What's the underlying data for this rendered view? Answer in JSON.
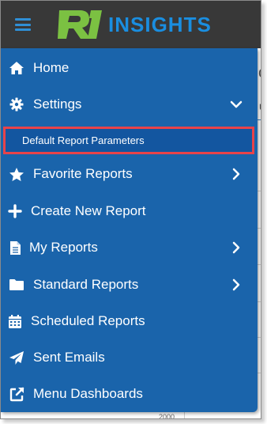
{
  "app": {
    "brand_mark": "R1",
    "brand_name": "INSIGHTS",
    "accent_color": "#1a8ee0",
    "menu_bg": "#1a64ab",
    "highlight_border": "#e8434a"
  },
  "menu": {
    "items": [
      {
        "label": "Home",
        "icon": "home-icon"
      },
      {
        "label": "Settings",
        "icon": "gear-icon",
        "expanded": true,
        "children": [
          {
            "label": "Default Report Parameters"
          }
        ]
      },
      {
        "label": "Favorite Reports",
        "icon": "star-icon"
      },
      {
        "label": "Create New Report",
        "icon": "plus-icon"
      },
      {
        "label": "My Reports",
        "icon": "document-icon"
      },
      {
        "label": "Standard Reports",
        "icon": "folder-icon"
      },
      {
        "label": "Scheduled Reports",
        "icon": "calendar-icon"
      },
      {
        "label": "Sent Emails",
        "icon": "paper-plane-icon"
      },
      {
        "label": "Menu Dashboards",
        "icon": "external-link-icon"
      }
    ]
  },
  "background": {
    "axis_value": "2000"
  }
}
